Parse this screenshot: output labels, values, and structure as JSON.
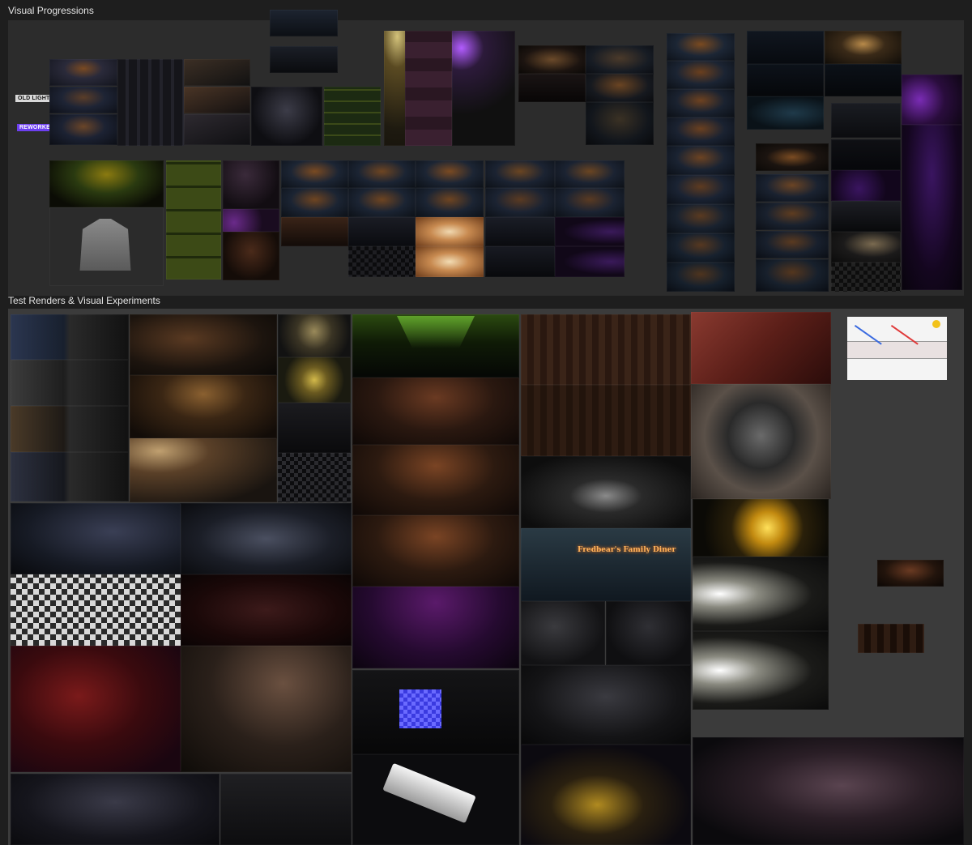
{
  "sections": {
    "visual_progressions": {
      "title": "Visual Progressions",
      "labels": {
        "old_lights": "OLD LIGHTS",
        "reworked": "REWORKED"
      }
    },
    "test_renders": {
      "title": "Test Renders & Visual Experiments"
    }
  },
  "signage": {
    "diner_sign": "Fredbear's Family Diner"
  },
  "colors": {
    "canvas_background": "#1e1e1e",
    "progressions_frame": "#2c2c2c",
    "test_renders_frame": "#3b3b3b",
    "reworked_badge": "#6d3ff0",
    "old_lights_badge": "#d9d9d9"
  }
}
